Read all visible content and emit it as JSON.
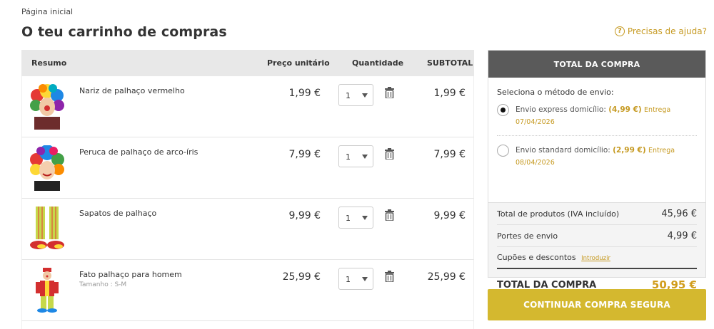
{
  "breadcrumb": "Página inicial",
  "title": "O teu carrinho de compras",
  "help": {
    "label": "Precisas de ajuda?",
    "icon": "question-circle-icon"
  },
  "table": {
    "headers": {
      "resumo": "Resumo",
      "preco": "Preço unitário",
      "quantidade": "Quantidade",
      "subtotal": "SUBTOTAL"
    },
    "items": [
      {
        "name": "Nariz de palhaço vermelho",
        "size": "",
        "price": "1,99 €",
        "qty": "1",
        "subtotal": "1,99 €"
      },
      {
        "name": "Peruca de palhaço de arco-íris",
        "size": "",
        "price": "7,99 €",
        "qty": "1",
        "subtotal": "7,99 €"
      },
      {
        "name": "Sapatos de palhaço",
        "size": "",
        "price": "9,99 €",
        "qty": "1",
        "subtotal": "9,99 €"
      },
      {
        "name": "Fato palhaço para homem",
        "size": "Tamanho : S-M",
        "price": "25,99 €",
        "qty": "1",
        "subtotal": "25,99 €"
      }
    ]
  },
  "summary": {
    "header": "TOTAL DA COMPRA",
    "shipping_title": "Seleciona o método de envio:",
    "options": [
      {
        "label": "Envio express domicílio:",
        "price": "(4,99 €)",
        "date": "Entrega 07/04/2026",
        "selected": true
      },
      {
        "label": "Envio standard domicílio:",
        "price": "(2,99 €)",
        "date": "Entrega 08/04/2026",
        "selected": false
      }
    ],
    "products_label": "Total de produtos (IVA incluído)",
    "products_value": "45,96 €",
    "shipping_label": "Portes de envio",
    "shipping_value": "4,99 €",
    "coupon_label": "Cupões e descontos",
    "coupon_link": "Introduzir",
    "total_label": "TOTAL DA COMPRA",
    "total_value": "50,95 €"
  },
  "cta": "CONTINUAR COMPRA SEGURA",
  "colors": {
    "accent": "#c69a22",
    "cta": "#d4b82f",
    "header_dark": "#5a5a5a",
    "total": "#d19d1c"
  }
}
